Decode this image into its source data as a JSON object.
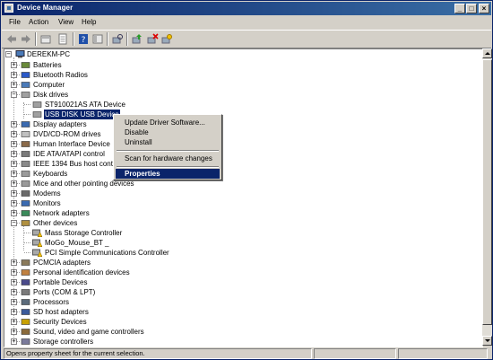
{
  "window": {
    "title": "Device Manager"
  },
  "menus": [
    "File",
    "Action",
    "View",
    "Help"
  ],
  "toolbar_icons": [
    "back-icon",
    "forward-icon",
    "up-icon",
    "properties-icon",
    "help-icon",
    "show-hide-icon",
    "scan-icon",
    "update-driver-icon",
    "uninstall-icon",
    "disable-icon"
  ],
  "tree": {
    "root": "DEREKM-PC",
    "nodes": [
      {
        "label": "Batteries",
        "icon": "battery-icon"
      },
      {
        "label": "Bluetooth Radios",
        "icon": "bluetooth-icon"
      },
      {
        "label": "Computer",
        "icon": "computer-icon"
      },
      {
        "label": "Disk drives",
        "icon": "disk-icon"
      },
      {
        "label": "ST910021AS ATA Device",
        "icon": "disk-icon"
      },
      {
        "label": "USB DISK USB Device",
        "icon": "disk-icon"
      },
      {
        "label": "Display adapters",
        "icon": "display-icon"
      },
      {
        "label": "DVD/CD-ROM drives",
        "icon": "cdrom-icon"
      },
      {
        "label": "Human Interface Device",
        "icon": "hid-icon"
      },
      {
        "label": "IDE ATA/ATAPI control",
        "icon": "ide-icon"
      },
      {
        "label": "IEEE 1394 Bus host cont",
        "icon": "ieee1394-icon"
      },
      {
        "label": "Keyboards",
        "icon": "keyboard-icon"
      },
      {
        "label": "Mice and other pointing devices",
        "icon": "mouse-icon"
      },
      {
        "label": "Modems",
        "icon": "modem-icon"
      },
      {
        "label": "Monitors",
        "icon": "monitor-icon"
      },
      {
        "label": "Network adapters",
        "icon": "network-icon"
      },
      {
        "label": "Other devices",
        "icon": "other-device-icon"
      },
      {
        "label": "Mass Storage Controller",
        "icon": "warning-device-icon"
      },
      {
        "label": "MoGo_Mouse_BT _",
        "icon": "warning-device-icon"
      },
      {
        "label": "PCI Simple Communications Controller",
        "icon": "warning-device-icon"
      },
      {
        "label": "PCMCIA adapters",
        "icon": "pcmcia-icon"
      },
      {
        "label": "Personal identification devices",
        "icon": "fingerprint-icon"
      },
      {
        "label": "Portable Devices",
        "icon": "portable-device-icon"
      },
      {
        "label": "Ports (COM & LPT)",
        "icon": "port-icon"
      },
      {
        "label": "Processors",
        "icon": "processor-icon"
      },
      {
        "label": "SD host adapters",
        "icon": "sd-icon"
      },
      {
        "label": "Security Devices",
        "icon": "security-icon"
      },
      {
        "label": "Sound, video and game controllers",
        "icon": "sound-icon"
      },
      {
        "label": "Storage controllers",
        "icon": "storage-icon"
      }
    ]
  },
  "context_menu": {
    "items": [
      "Update Driver Software...",
      "Disable",
      "Uninstall",
      "Scan for hardware changes",
      "Properties"
    ],
    "highlighted": "Properties"
  },
  "status": {
    "text": "Opens property sheet for the current selection."
  },
  "colors": {
    "titlebar": "#0a246a",
    "selection": "#0a246a",
    "chrome": "#d4d0c8"
  }
}
